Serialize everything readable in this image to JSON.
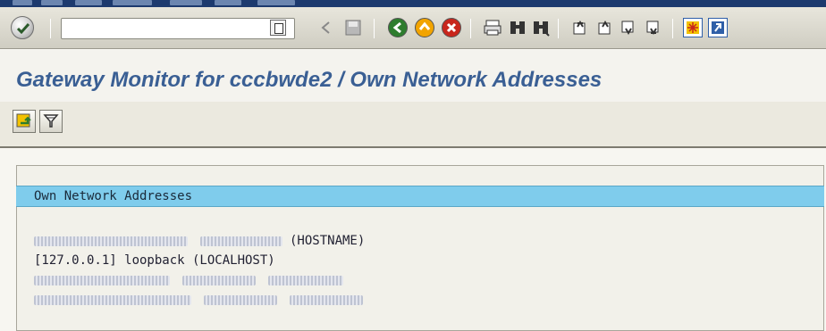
{
  "toolbar": {
    "command_field_value": "",
    "colors": {
      "back": "#2e7d2e",
      "exit": "#f2a400",
      "cancel": "#c8261c",
      "create_session": "#2f5fa8"
    },
    "icons": [
      "enter-icon",
      "command-history-icon",
      "back-nav-icon",
      "save-icon",
      "back-icon",
      "exit-icon",
      "cancel-icon",
      "print-icon",
      "find-icon",
      "find-next-icon",
      "first-page-icon",
      "previous-page-icon",
      "next-page-icon",
      "last-page-icon",
      "create-session-icon",
      "shortcut-icon"
    ]
  },
  "title": "Gateway Monitor for cccbwde2 / Own Network Addresses",
  "app_toolbar": {
    "icons": [
      "refresh-icon",
      "filter-icon"
    ]
  },
  "list": {
    "header": "Own Network Addresses",
    "rows": [
      {
        "suffix": "(HOSTNAME)"
      },
      {
        "text": "[127.0.0.1] loopback (LOCALHOST)"
      },
      {
        "suffix": ""
      },
      {
        "suffix": ""
      }
    ]
  }
}
